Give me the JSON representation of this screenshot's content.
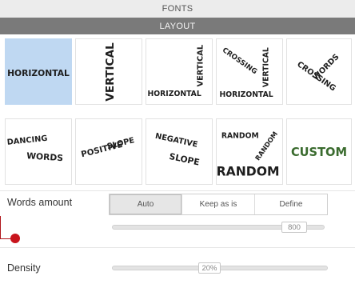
{
  "header": {
    "fonts_label": "FONTS",
    "layout_label": "LAYOUT"
  },
  "layouts": [
    {
      "id": "horizontal",
      "selected": true
    },
    {
      "id": "vertical",
      "selected": false
    },
    {
      "id": "horizontal-vertical",
      "selected": false
    },
    {
      "id": "crossing-vertical-horizontal",
      "selected": false
    },
    {
      "id": "crossing-words",
      "selected": false
    },
    {
      "id": "dancing-words",
      "selected": false
    },
    {
      "id": "positive-slope",
      "selected": false
    },
    {
      "id": "negative-slope",
      "selected": false
    },
    {
      "id": "random",
      "selected": false
    },
    {
      "id": "custom",
      "selected": false
    }
  ],
  "labels": {
    "horizontal": "Horizontal",
    "vertical": "Vertical",
    "crossing": "Crossing",
    "words": "Words",
    "dancing": "Dancing",
    "positive": "Positive",
    "negative": "Negative",
    "slope": "Slope",
    "random": "Random",
    "custom": "Custom"
  },
  "words_amount": {
    "label": "Words amount",
    "options": [
      "Auto",
      "Keep as is",
      "Define"
    ],
    "active_option": "Auto",
    "value": "800"
  },
  "density": {
    "label": "Density",
    "value": "20%"
  },
  "colors": {
    "selected_tile": "#bfd8f2",
    "layout_header": "#7a7a7a",
    "custom_text": "#3a6b2e",
    "callout": "#c8141c"
  }
}
